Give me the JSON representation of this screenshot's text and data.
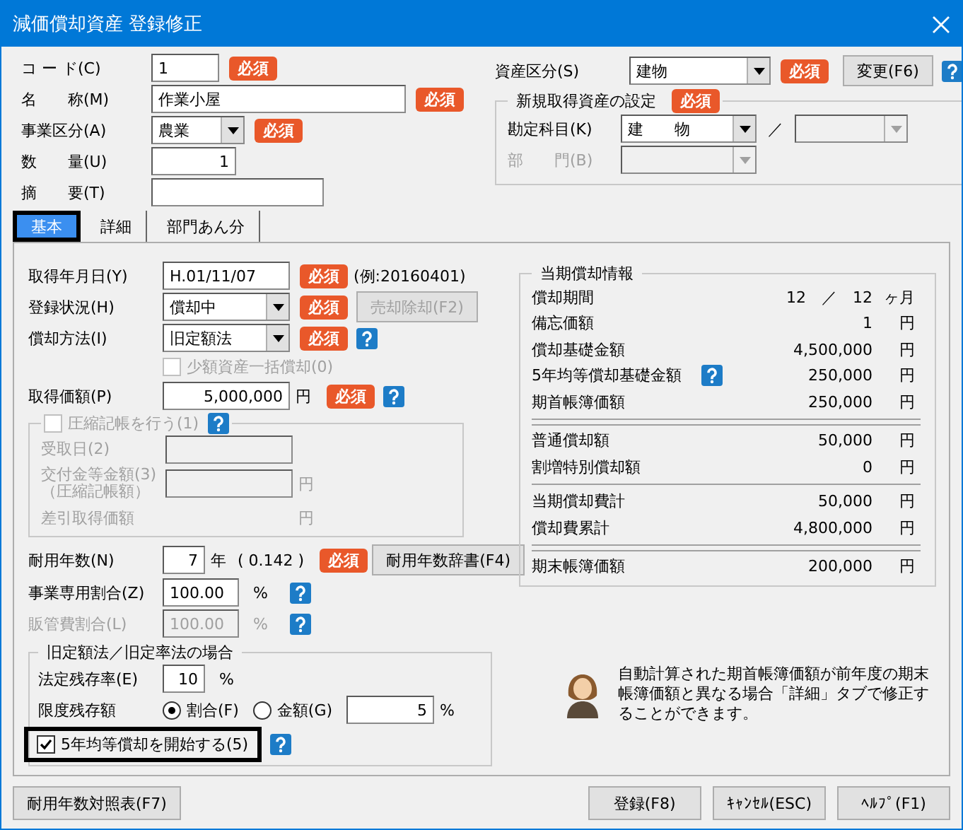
{
  "window": {
    "title": "減価償却資産 登録修正"
  },
  "header": {
    "fields": [
      {
        "label": "コ ー ド(C)",
        "kind": "short",
        "value": "1",
        "required": "必須"
      },
      {
        "label": "名　　称(M)",
        "kind": "long",
        "value": "作業小屋",
        "required": "必須"
      },
      {
        "label": "事業区分(A)",
        "kind": "select",
        "value": "農業",
        "required": "必須"
      },
      {
        "label": "数　　量(U)",
        "kind": "number",
        "value": "1"
      },
      {
        "label": "摘　　要(T)",
        "kind": "wide"
      }
    ],
    "asset_class": {
      "label": "資産区分(S)",
      "value": "建物",
      "required": "必須",
      "button": "変更(F6)",
      "help": true
    },
    "new_asset": {
      "title": "新規取得資産の設定",
      "required": "必須",
      "separator": "／",
      "account": {
        "label": "勘定科目(K)",
        "value": "建　　物",
        "disabled": false
      },
      "department": {
        "label": "部　　門(B)",
        "disabled": true
      }
    }
  },
  "tabs": [
    {
      "label": "基本",
      "selected": true,
      "highlighted": true
    },
    {
      "label": "詳細",
      "selected": false,
      "highlighted": false
    },
    {
      "label": "部門あん分",
      "selected": false,
      "highlighted": false
    }
  ],
  "basic": {
    "acquired_date": {
      "label": "取得年月日(Y)",
      "value": "H.01/11/07",
      "required": "必須",
      "example": "(例:20160401)"
    },
    "status": {
      "label": "登録状況(H)",
      "value": "償却中",
      "required": "必須",
      "button": {
        "label": "売却除却(F2)",
        "disabled": true
      }
    },
    "method": {
      "label": "償却方法(I)",
      "value": "旧定額法",
      "required": "必須",
      "help": true
    },
    "small_asset": {
      "label": "少額資産一括償却(0)",
      "checked": false,
      "disabled": true
    },
    "cost": {
      "label": "取得価額(P)",
      "value": "5,000,000",
      "unit": "円",
      "required": "必須",
      "help": true
    },
    "compression": {
      "label": "圧縮記帳を行う(1)",
      "checked": false,
      "disabled": true,
      "help": true,
      "fields": [
        {
          "label": "受取日(2)",
          "kind": "input"
        },
        {
          "label": "交付金等金額(3)",
          "sublabel": "（圧縮記帳額）",
          "kind": "input",
          "unit": "円"
        },
        {
          "label": "差引取得価額",
          "kind": "plain",
          "unit": "円"
        }
      ]
    },
    "useful_life": {
      "label": "耐用年数(N)",
      "value": "7",
      "unit": "年",
      "rate": "( 0.142 )",
      "required": "必須",
      "button": "耐用年数辞書(F4)"
    },
    "ratios": [
      {
        "label": "事業専用割合(Z)",
        "value": "100.00",
        "unit": "%",
        "disabled": false,
        "help": true
      },
      {
        "label": "販管費割合(L)",
        "value": "100.00",
        "unit": "%",
        "disabled": true,
        "help": true
      }
    ],
    "old_method": {
      "title": "旧定額法／旧定率法の場合",
      "residual": {
        "label": "法定残存率(E)",
        "value": "10",
        "unit": "%"
      },
      "limit": {
        "label": "限度残存額",
        "options": [
          {
            "label": "割合(F)",
            "selected": true
          },
          {
            "label": "金額(G)",
            "selected": false
          }
        ],
        "value": "5",
        "unit": "%"
      },
      "five_year": {
        "label": "5年均等償却を開始する(5)",
        "checked": true,
        "highlighted": true,
        "help": true
      }
    },
    "info": {
      "title": "当期償却情報",
      "groups": [
        {
          "rows": [
            {
              "label": "償却期間",
              "value": "12　／　12",
              "unit": "ヶ月"
            },
            {
              "label": "備忘価額",
              "value": "1",
              "unit": "円"
            },
            {
              "label": "償却基礎金額",
              "value": "4,500,000",
              "unit": "円"
            },
            {
              "label": "5年均等償却基礎金額",
              "value": "250,000",
              "unit": "円",
              "help": true
            },
            {
              "label": "期首帳簿価額",
              "value": "250,000",
              "unit": "円"
            }
          ]
        },
        {
          "double_rule": true,
          "rows": [
            {
              "label": "普通償却額",
              "value": "50,000",
              "unit": "円"
            },
            {
              "label": "割増特別償却額",
              "value": "0",
              "unit": "円"
            }
          ]
        },
        {
          "double_rule": false,
          "rows": [
            {
              "label": "当期償却費計",
              "value": "50,000",
              "unit": "円"
            },
            {
              "label": "償却費累計",
              "value": "4,800,000",
              "unit": "円"
            }
          ]
        },
        {
          "double_rule": true,
          "rows": [
            {
              "label": "期末帳簿価額",
              "value": "200,000",
              "unit": "円"
            }
          ]
        }
      ]
    },
    "note": "自動計算された期首帳簿価額が前年度の期末帳簿価額と異なる場合「詳細」タブで修正することができます。"
  },
  "footer": {
    "left_button": "耐用年数対照表(F7)",
    "buttons": [
      "登録(F8)",
      "ｷｬﾝｾﾙ(ESC)",
      "ﾍﾙﾌﾟ(F1)"
    ]
  }
}
